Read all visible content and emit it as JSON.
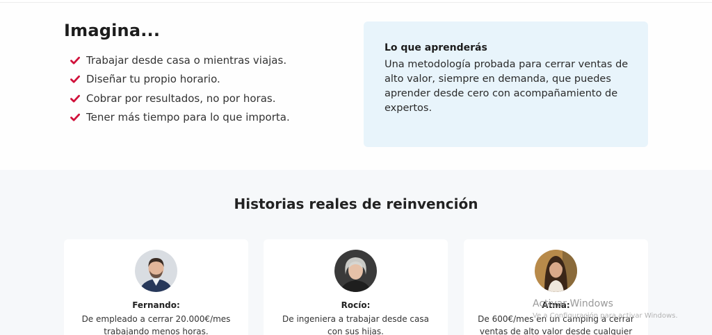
{
  "imagine": {
    "title": "Imagina...",
    "items": [
      "Trabajar desde casa o mientras viajas.",
      "Diseñar tu propio horario.",
      "Cobrar por resultados, no por horas.",
      "Tener más tiempo para lo que importa."
    ]
  },
  "learn": {
    "title": "Lo que aprenderás",
    "text": "Una metodología probada para cerrar ventas de alto valor, siempre en demanda, que puedes aprender desde cero con acompañamiento de expertos."
  },
  "stories": {
    "title": "Historias reales de reinvención",
    "cards": [
      {
        "name": "Fernando:",
        "story": "De empleado a cerrar 20.000€/mes trabajando menos horas."
      },
      {
        "name": "Rocío:",
        "story": "De ingeniera a trabajar desde casa con sus hijas."
      },
      {
        "name": "Atma:",
        "story": "De 600€/mes en un camping a cerrar ventas de alto valor desde cualquier"
      }
    ]
  },
  "watermark": {
    "title": "Activar Windows",
    "subtitle": "Ve a Configuración para activar Windows."
  },
  "colors": {
    "check": "#d0103a",
    "learn_bg": "#e8f4fb",
    "section_bg": "#f6f8fa"
  },
  "icons": {
    "bullet": "check-icon"
  }
}
